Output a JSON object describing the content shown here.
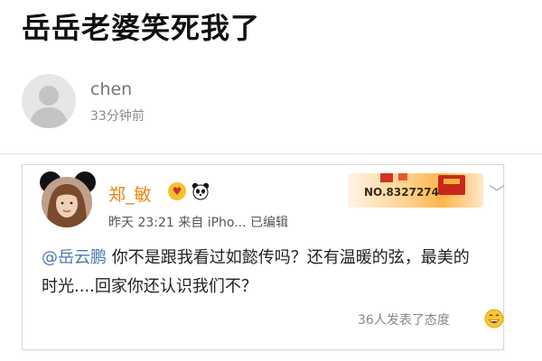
{
  "post": {
    "title": "岳岳老婆笑死我了",
    "author": "chen",
    "time": "33分钟前"
  },
  "weibo_card": {
    "user_name": "郑_敏",
    "meta": "昨天 23:21  来自 iPho...  已编辑",
    "decoration_number": "NO.8327274",
    "mention": "@岳云鹏",
    "body": " 你不是跟我看过如懿传吗？还有温暖的弦，最美的时光....回家你还认识我们不？",
    "reactions": "36人发表了态度",
    "icons": [
      "heart-eyes-emoji-icon",
      "panda-icon",
      "chevron-down-icon",
      "grin-emoji-icon"
    ]
  },
  "colors": {
    "user_name": "#f0830f",
    "mention": "#4a79b0",
    "muted": "#8a8a8a"
  }
}
